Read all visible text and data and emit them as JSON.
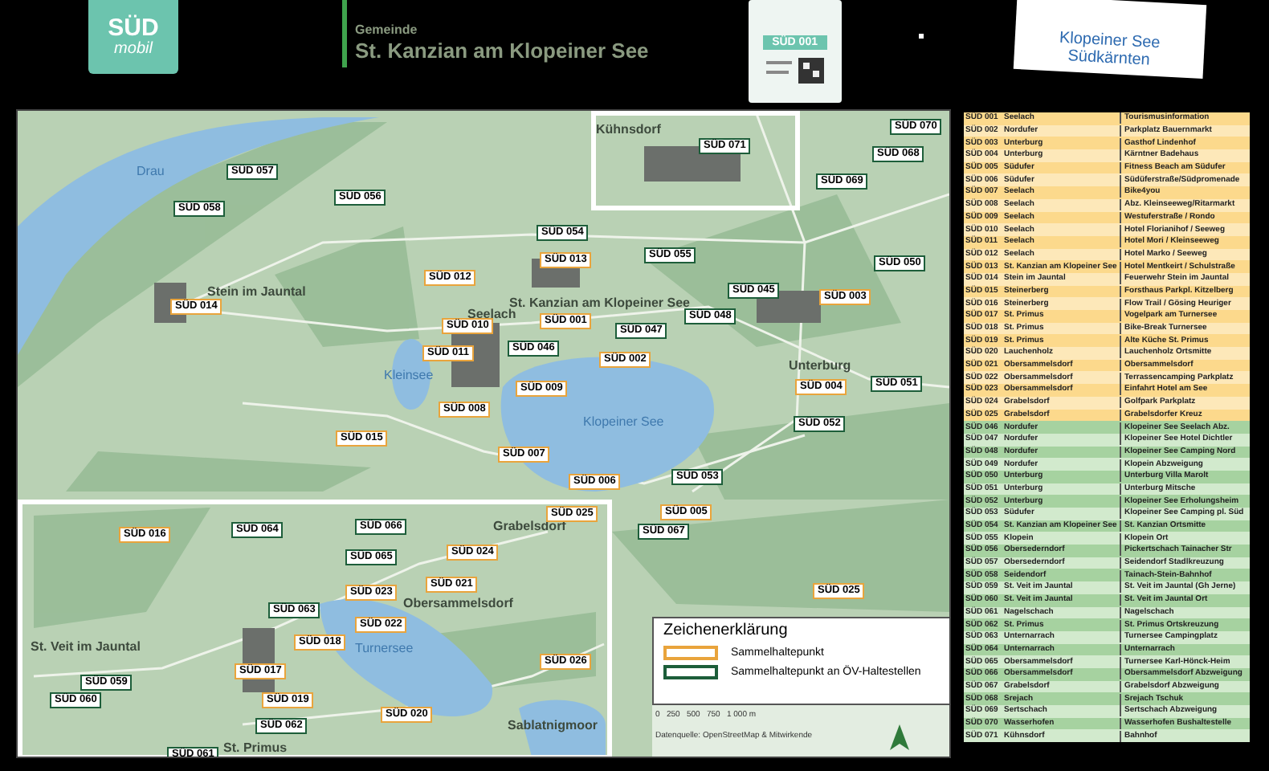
{
  "header": {
    "logo": {
      "top": "SÜD",
      "bottom": "mobil"
    },
    "kicker": "Gemeinde",
    "title": "St. Kanzian am Klopeiner See",
    "badge": "SÜD 001",
    "region_logo": {
      "line1": "Klopeiner See",
      "line2": "Südkärnten"
    }
  },
  "map": {
    "places": [
      {
        "name": "Drau",
        "kind": "water"
      },
      {
        "name": "Kühnsdorf",
        "kind": "town"
      },
      {
        "name": "Stein im Jauntal",
        "kind": "town"
      },
      {
        "name": "Seelach",
        "kind": "town"
      },
      {
        "name": "St. Kanzian am Klopeiner See",
        "kind": "town"
      },
      {
        "name": "Kleinsee",
        "kind": "water"
      },
      {
        "name": "Klopeiner See",
        "kind": "water"
      },
      {
        "name": "Unterburg",
        "kind": "town"
      },
      {
        "name": "Grabelsdorf",
        "kind": "town"
      },
      {
        "name": "Obersammelsdorf",
        "kind": "town"
      },
      {
        "name": "Turnersee",
        "kind": "water"
      },
      {
        "name": "St. Veit im Jauntal",
        "kind": "town"
      },
      {
        "name": "St. Primus",
        "kind": "town"
      },
      {
        "name": "Sablatnigmoor",
        "kind": "town"
      }
    ],
    "stops": [
      {
        "label": "SÜD 057",
        "kind": "ov"
      },
      {
        "label": "SÜD 058",
        "kind": "ov"
      },
      {
        "label": "SÜD 056",
        "kind": "ov"
      },
      {
        "label": "SÜD 054",
        "kind": "ov"
      },
      {
        "label": "SÜD 013",
        "kind": "collect"
      },
      {
        "label": "SÜD 012",
        "kind": "collect"
      },
      {
        "label": "SÜD 014",
        "kind": "collect"
      },
      {
        "label": "SÜD 010",
        "kind": "collect"
      },
      {
        "label": "SÜD 001",
        "kind": "collect"
      },
      {
        "label": "SÜD 011",
        "kind": "collect"
      },
      {
        "label": "SÜD 046",
        "kind": "ov"
      },
      {
        "label": "SÜD 009",
        "kind": "collect"
      },
      {
        "label": "SÜD 008",
        "kind": "collect"
      },
      {
        "label": "SÜD 007",
        "kind": "collect"
      },
      {
        "label": "SÜD 006",
        "kind": "collect"
      },
      {
        "label": "SÜD 015",
        "kind": "collect"
      },
      {
        "label": "SÜD 071",
        "kind": "ov"
      },
      {
        "label": "SÜD 070",
        "kind": "ov"
      },
      {
        "label": "SÜD 068",
        "kind": "ov"
      },
      {
        "label": "SÜD 069",
        "kind": "ov"
      },
      {
        "label": "SÜD 055",
        "kind": "ov"
      },
      {
        "label": "SÜD 050",
        "kind": "ov"
      },
      {
        "label": "SÜD 045",
        "kind": "ov"
      },
      {
        "label": "SÜD 003",
        "kind": "collect"
      },
      {
        "label": "SÜD 048",
        "kind": "ov"
      },
      {
        "label": "SÜD 047",
        "kind": "ov"
      },
      {
        "label": "SÜD 002",
        "kind": "collect"
      },
      {
        "label": "SÜD 004",
        "kind": "collect"
      },
      {
        "label": "SÜD 051",
        "kind": "ov"
      },
      {
        "label": "SÜD 052",
        "kind": "ov"
      },
      {
        "label": "SÜD 053",
        "kind": "ov"
      },
      {
        "label": "SÜD 005",
        "kind": "collect"
      },
      {
        "label": "SÜD 067",
        "kind": "ov"
      },
      {
        "label": "SÜD 025",
        "kind": "collect"
      },
      {
        "label": "SÜD 016",
        "kind": "collect"
      },
      {
        "label": "SÜD 064",
        "kind": "ov"
      },
      {
        "label": "SÜD 066",
        "kind": "ov"
      },
      {
        "label": "SÜD 025",
        "kind": "collect"
      },
      {
        "label": "SÜD 024",
        "kind": "collect"
      },
      {
        "label": "SÜD 065",
        "kind": "ov"
      },
      {
        "label": "SÜD 023",
        "kind": "collect"
      },
      {
        "label": "SÜD 021",
        "kind": "collect"
      },
      {
        "label": "SÜD 063",
        "kind": "ov"
      },
      {
        "label": "SÜD 022",
        "kind": "collect"
      },
      {
        "label": "SÜD 018",
        "kind": "collect"
      },
      {
        "label": "SÜD 017",
        "kind": "collect"
      },
      {
        "label": "SÜD 026",
        "kind": "collect"
      },
      {
        "label": "SÜD 059",
        "kind": "ov"
      },
      {
        "label": "SÜD 060",
        "kind": "ov"
      },
      {
        "label": "SÜD 019",
        "kind": "collect"
      },
      {
        "label": "SÜD 020",
        "kind": "collect"
      },
      {
        "label": "SÜD 062",
        "kind": "ov"
      },
      {
        "label": "SÜD 061",
        "kind": "ov"
      }
    ],
    "legend": {
      "title": "Zeichenerklärung",
      "items": [
        {
          "label": "Sammelhaltepunkt",
          "kind": "collect"
        },
        {
          "label": "Sammelhaltepunkt an ÖV-Haltestellen",
          "kind": "ov"
        }
      ]
    },
    "scale": "0   250   500   750   1 000 m",
    "source": "Datenquelle: OpenStreetMap & Mitwirkende"
  },
  "table": {
    "rows": [
      {
        "id": "SÜD 001",
        "place": "Seelach",
        "stop": "Tourismusinformation",
        "kind": "collect"
      },
      {
        "id": "SÜD 002",
        "place": "Nordufer",
        "stop": "Parkplatz Bauernmarkt",
        "kind": "collect"
      },
      {
        "id": "SÜD 003",
        "place": "Unterburg",
        "stop": "Gasthof Lindenhof",
        "kind": "collect"
      },
      {
        "id": "SÜD 004",
        "place": "Unterburg",
        "stop": "Kärntner Badehaus",
        "kind": "collect"
      },
      {
        "id": "SÜD 005",
        "place": "Südufer",
        "stop": "Fitness Beach am Südufer",
        "kind": "collect"
      },
      {
        "id": "SÜD 006",
        "place": "Südufer",
        "stop": "Südüferstraße/Südpromenade",
        "kind": "collect"
      },
      {
        "id": "SÜD 007",
        "place": "Seelach",
        "stop": "Bike4you",
        "kind": "collect"
      },
      {
        "id": "SÜD 008",
        "place": "Seelach",
        "stop": "Abz. Kleinseeweg/Ritarmarkt",
        "kind": "collect"
      },
      {
        "id": "SÜD 009",
        "place": "Seelach",
        "stop": "Westuferstraße / Rondo",
        "kind": "collect"
      },
      {
        "id": "SÜD 010",
        "place": "Seelach",
        "stop": "Hotel Florianihof / Seeweg",
        "kind": "collect"
      },
      {
        "id": "SÜD 011",
        "place": "Seelach",
        "stop": "Hotel Mori / Kleinseeweg",
        "kind": "collect"
      },
      {
        "id": "SÜD 012",
        "place": "Seelach",
        "stop": "Hotel Marko / Seeweg",
        "kind": "collect"
      },
      {
        "id": "SÜD 013",
        "place": "St. Kanzian am Klopeiner See",
        "stop": "Hotel Mentkeirt / Schulstraße",
        "kind": "collect"
      },
      {
        "id": "SÜD 014",
        "place": "Stein im Jauntal",
        "stop": "Feuerwehr Stein im Jauntal",
        "kind": "collect"
      },
      {
        "id": "SÜD 015",
        "place": "Steinerberg",
        "stop": "Forsthaus Parkpl. Kitzelberg",
        "kind": "collect"
      },
      {
        "id": "SÜD 016",
        "place": "Steinerberg",
        "stop": "Flow Trail / Gösing Heuriger",
        "kind": "collect"
      },
      {
        "id": "SÜD 017",
        "place": "St. Primus",
        "stop": "Vogelpark am Turnersee",
        "kind": "collect"
      },
      {
        "id": "SÜD 018",
        "place": "St. Primus",
        "stop": "Bike-Break Turnersee",
        "kind": "collect"
      },
      {
        "id": "SÜD 019",
        "place": "St. Primus",
        "stop": "Alte Küche St. Primus",
        "kind": "collect"
      },
      {
        "id": "SÜD 020",
        "place": "Lauchenholz",
        "stop": "Lauchenholz Ortsmitte",
        "kind": "collect"
      },
      {
        "id": "SÜD 021",
        "place": "Obersammelsdorf",
        "stop": "Obersammelsdorf",
        "kind": "collect"
      },
      {
        "id": "SÜD 022",
        "place": "Obersammelsdorf",
        "stop": "Terrassencamping Parkplatz",
        "kind": "collect"
      },
      {
        "id": "SÜD 023",
        "place": "Obersammelsdorf",
        "stop": "Einfahrt Hotel am See",
        "kind": "collect"
      },
      {
        "id": "SÜD 024",
        "place": "Grabelsdorf",
        "stop": "Golfpark Parkplatz",
        "kind": "collect"
      },
      {
        "id": "SÜD 025",
        "place": "Grabelsdorf",
        "stop": "Grabelsdorfer Kreuz",
        "kind": "collect"
      },
      {
        "id": "SÜD 046",
        "place": "Nordufer",
        "stop": "Klopeiner See Seelach Abz.",
        "kind": "ov"
      },
      {
        "id": "SÜD 047",
        "place": "Nordufer",
        "stop": "Klopeiner See Hotel Dichtler",
        "kind": "ov"
      },
      {
        "id": "SÜD 048",
        "place": "Nordufer",
        "stop": "Klopeiner See Camping Nord",
        "kind": "ov"
      },
      {
        "id": "SÜD 049",
        "place": "Nordufer",
        "stop": "Klopein Abzweigung",
        "kind": "ov"
      },
      {
        "id": "SÜD 050",
        "place": "Unterburg",
        "stop": "Unterburg Villa Marolt",
        "kind": "ov"
      },
      {
        "id": "SÜD 051",
        "place": "Unterburg",
        "stop": "Unterburg Mitsche",
        "kind": "ov"
      },
      {
        "id": "SÜD 052",
        "place": "Unterburg",
        "stop": "Klopeiner See Erholungsheim",
        "kind": "ov"
      },
      {
        "id": "SÜD 053",
        "place": "Südufer",
        "stop": "Klopeiner See Camping pl. Süd",
        "kind": "ov"
      },
      {
        "id": "SÜD 054",
        "place": "St. Kanzian am Klopeiner See",
        "stop": "St. Kanzian Ortsmitte",
        "kind": "ov"
      },
      {
        "id": "SÜD 055",
        "place": "Klopein",
        "stop": "Klopein Ort",
        "kind": "ov"
      },
      {
        "id": "SÜD 056",
        "place": "Obersederndorf",
        "stop": "Pickertschach Tainacher Str",
        "kind": "ov"
      },
      {
        "id": "SÜD 057",
        "place": "Obersederndorf",
        "stop": "Seidendorf Stadlkreuzung",
        "kind": "ov"
      },
      {
        "id": "SÜD 058",
        "place": "Seidendorf",
        "stop": "Tainach-Stein-Bahnhof",
        "kind": "ov"
      },
      {
        "id": "SÜD 059",
        "place": "St. Veit im Jauntal",
        "stop": "St. Veit im Jauntal (Gh Jerne)",
        "kind": "ov"
      },
      {
        "id": "SÜD 060",
        "place": "St. Veit im Jauntal",
        "stop": "St. Veit im Jauntal Ort",
        "kind": "ov"
      },
      {
        "id": "SÜD 061",
        "place": "Nagelschach",
        "stop": "Nagelschach",
        "kind": "ov"
      },
      {
        "id": "SÜD 062",
        "place": "St. Primus",
        "stop": "St. Primus Ortskreuzung",
        "kind": "ov"
      },
      {
        "id": "SÜD 063",
        "place": "Unternarrach",
        "stop": "Turnersee Campingplatz",
        "kind": "ov"
      },
      {
        "id": "SÜD 064",
        "place": "Unternarrach",
        "stop": "Unternarrach",
        "kind": "ov"
      },
      {
        "id": "SÜD 065",
        "place": "Obersammelsdorf",
        "stop": "Turnersee Karl-Hönck-Heim",
        "kind": "ov"
      },
      {
        "id": "SÜD 066",
        "place": "Obersammelsdorf",
        "stop": "Obersammelsdorf Abzweigung",
        "kind": "ov"
      },
      {
        "id": "SÜD 067",
        "place": "Grabelsdorf",
        "stop": "Grabelsdorf Abzweigung",
        "kind": "ov"
      },
      {
        "id": "SÜD 068",
        "place": "Srejach",
        "stop": "Srejach Tschuk",
        "kind": "ov"
      },
      {
        "id": "SÜD 069",
        "place": "Sertschach",
        "stop": "Sertschach Abzweigung",
        "kind": "ov"
      },
      {
        "id": "SÜD 070",
        "place": "Wasserhofen",
        "stop": "Wasserhofen Bushaltestelle",
        "kind": "ov"
      },
      {
        "id": "SÜD 071",
        "place": "Kühnsdorf",
        "stop": "Bahnhof",
        "kind": "ov"
      }
    ]
  }
}
